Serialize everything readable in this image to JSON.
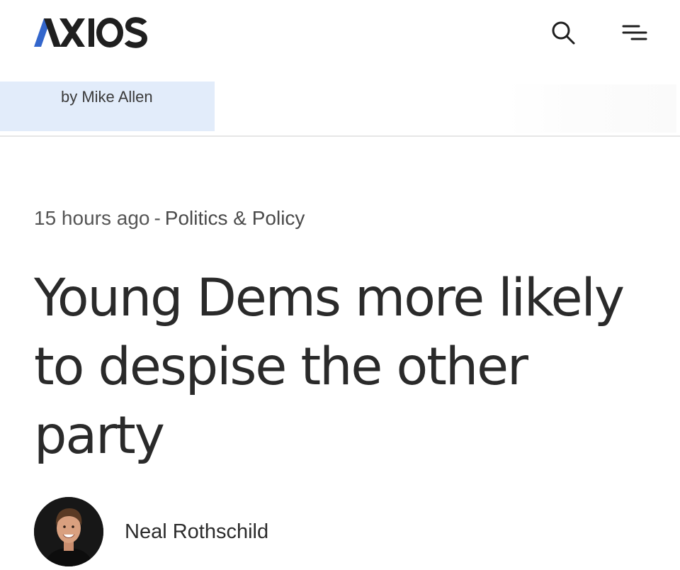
{
  "header": {
    "logo_text": "AXIOS",
    "accent_color": "#3366cc",
    "search_icon": "search-icon",
    "menu_icon": "menu-icon"
  },
  "newsletter": {
    "byline": "by Mike Allen",
    "box_color": "#e2ecfa"
  },
  "article": {
    "timestamp": "15 hours ago",
    "separator": "-",
    "section": "Politics & Policy",
    "headline": "Young Dems more likely to despise the other party",
    "author": "Neal Rothschild"
  }
}
